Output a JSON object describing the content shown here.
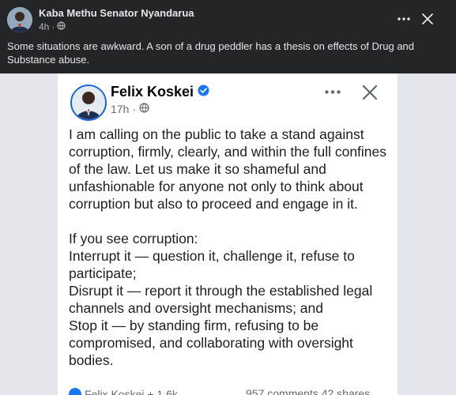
{
  "outer_post": {
    "author": "Kaba Methu Senator Nyandarua",
    "time": "4h",
    "audience_icon": "globe-icon",
    "text": "Some situations are awkward. A son of a drug peddler has a thesis on effects of Drug and Substance abuse."
  },
  "shared_post": {
    "author": "Felix Koskei",
    "verified_icon": "verified-badge-icon",
    "time": "17h",
    "audience_icon": "globe-icon",
    "body_paragraphs": [
      "I am calling on the public to take a stand against corruption, firmly, clearly, and within the full confines of the law. Let us make it so shameful and unfashionable for anyone not only to think about corruption but also to proceed and engage in it."
    ],
    "body_lines": [
      "If you see corruption:",
      "Interrupt it — question it, challenge it, refuse to participate;",
      "Disrupt it — report it through the established legal channels and oversight mechanisms; and",
      "Stop it — by standing firm, refusing to be compromised, and collaborating with oversight bodies."
    ],
    "footer": {
      "reactions": "Felix Koskei + 1.6k",
      "comments_shares": "957 comments  42 shares"
    }
  },
  "colors": {
    "outer_background": "#242526",
    "card_background": "#ffffff",
    "verified_blue": "#1877f2"
  }
}
